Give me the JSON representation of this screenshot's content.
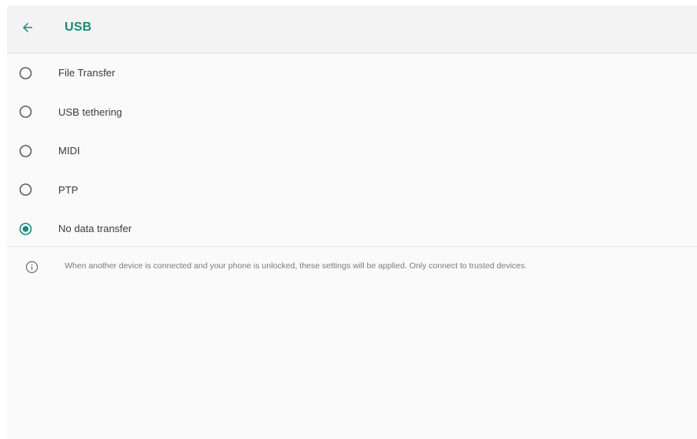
{
  "header": {
    "title": "USB",
    "back_icon": "arrow-left-icon",
    "accent_color": "#1a8a7a"
  },
  "options": [
    {
      "label": "File Transfer",
      "selected": false
    },
    {
      "label": "USB tethering",
      "selected": false
    },
    {
      "label": "MIDI",
      "selected": false
    },
    {
      "label": "PTP",
      "selected": false
    },
    {
      "label": "No data transfer",
      "selected": true
    }
  ],
  "info": {
    "icon": "info-icon",
    "text": "When another device is connected and your phone is unlocked, these settings will be applied. Only connect to trusted devices."
  }
}
